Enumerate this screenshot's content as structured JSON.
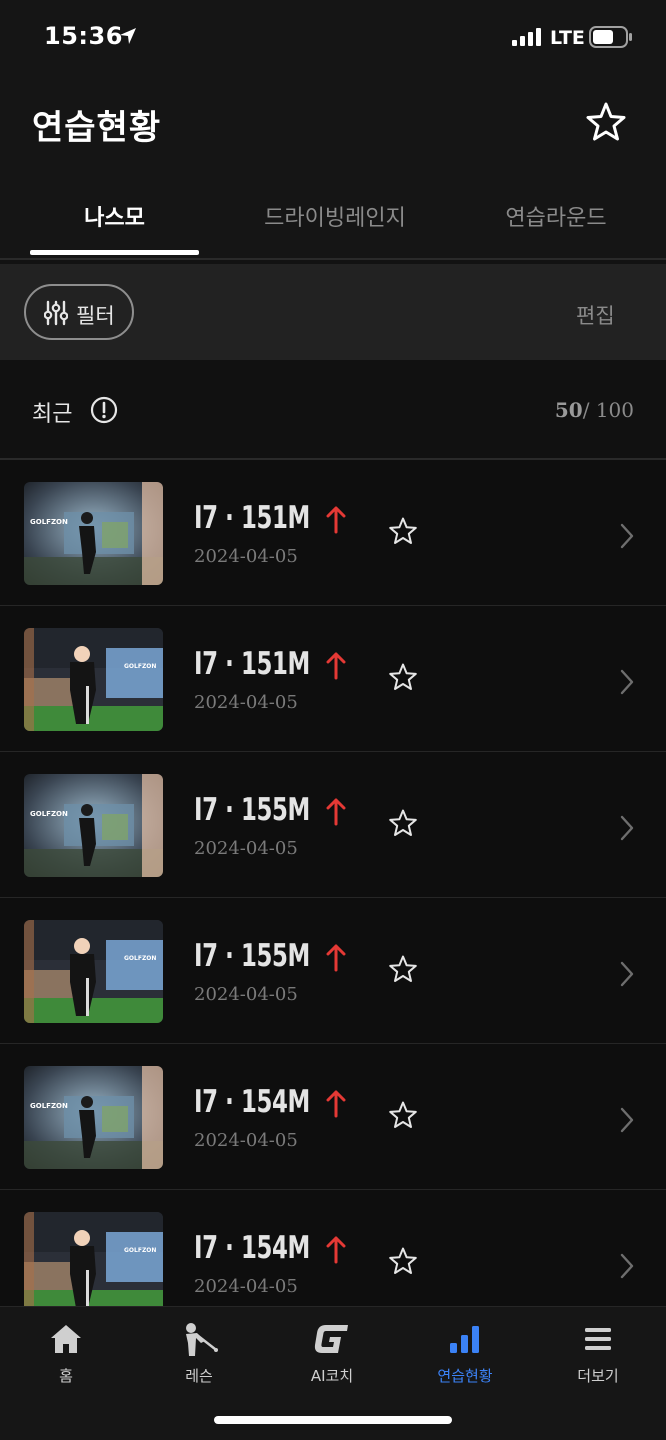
{
  "status": {
    "time": "15:36",
    "network": "LTE"
  },
  "header": {
    "title": "연습현황",
    "tabs": [
      {
        "label": "나스모",
        "active": true
      },
      {
        "label": "드라이빙레인지",
        "active": false
      },
      {
        "label": "연습라운드",
        "active": false
      }
    ]
  },
  "filter": {
    "filter_label": "필터",
    "edit_label": "편집"
  },
  "recent": {
    "label": "최근",
    "count_current": "50",
    "count_total": "/ 100"
  },
  "items": [
    {
      "club": "I7",
      "distance": "151M",
      "date": "2024-04-05",
      "thumb_variant": "side"
    },
    {
      "club": "I7",
      "distance": "151M",
      "date": "2024-04-05",
      "thumb_variant": "front"
    },
    {
      "club": "I7",
      "distance": "155M",
      "date": "2024-04-05",
      "thumb_variant": "side"
    },
    {
      "club": "I7",
      "distance": "155M",
      "date": "2024-04-05",
      "thumb_variant": "front"
    },
    {
      "club": "I7",
      "distance": "154M",
      "date": "2024-04-05",
      "thumb_variant": "side"
    },
    {
      "club": "I7",
      "distance": "154M",
      "date": "2024-04-05",
      "thumb_variant": "front"
    }
  ],
  "nav": [
    {
      "label": "홈",
      "icon": "home-icon",
      "active": false
    },
    {
      "label": "레슨",
      "icon": "golfer-icon",
      "active": false
    },
    {
      "label": "AI코치",
      "icon": "g-logo-icon",
      "active": false
    },
    {
      "label": "연습현황",
      "icon": "bar-chart-icon",
      "active": true
    },
    {
      "label": "더보기",
      "icon": "menu-icon",
      "active": false
    }
  ],
  "colors": {
    "accent": "#3b82f6",
    "up_arrow": "#e53935",
    "background": "#121212"
  }
}
